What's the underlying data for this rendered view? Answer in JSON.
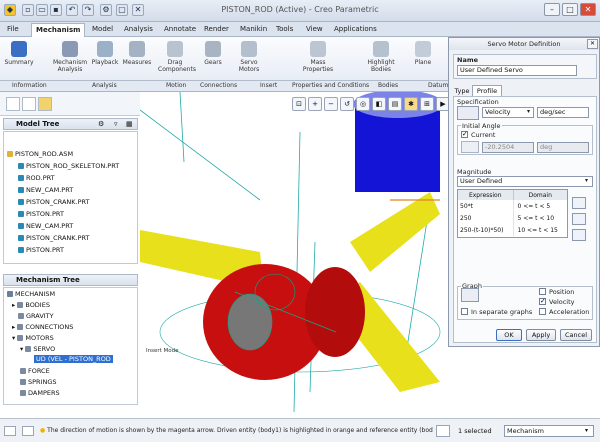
{
  "window": {
    "title": "PISTON_ROD (Active) - Creo Parametric"
  },
  "menu_tabs": [
    "File",
    "Mechanism",
    "Model",
    "Analysis",
    "Annotate",
    "Render",
    "Manikin",
    "Tools",
    "View",
    "Applications"
  ],
  "ribbon": {
    "buttons": [
      "Summary",
      "Mechanism Analysis",
      "Playback",
      "Measures",
      "Drag Components",
      "Gears",
      "Servo Motors",
      "Mass Properties",
      "Highlight Bodies",
      "Plane"
    ],
    "groups": [
      "Information",
      "Analysis",
      "Motion",
      "Connections",
      "Insert",
      "Properties and Conditions",
      "Bodies",
      "Datum"
    ]
  },
  "model_tree": {
    "header": "Model Tree",
    "items": [
      "PISTON_ROD.ASM",
      "PISTON_ROD_SKELETON.PRT",
      "ROD.PRT",
      "NEW_CAM.PRT",
      "PISTON_CRANK.PRT",
      "PISTON.PRT",
      "NEW_CAM.PRT",
      "PISTON_CRANK.PRT",
      "PISTON.PRT"
    ]
  },
  "mechanism_tree": {
    "header": "Mechanism Tree",
    "items": [
      "MECHANISM",
      "BODIES",
      "GRAVITY",
      "CONNECTIONS",
      "MOTORS",
      "SERVO",
      "UD (VEL - PISTON_ROD",
      "FORCE",
      "SPRINGS",
      "DAMPERS"
    ]
  },
  "viewport": {
    "label": "Insert Mode"
  },
  "dialog": {
    "title": "Servo Motor Definition",
    "name_label": "Name",
    "name_value": "User Defined Servo",
    "tabs": [
      "Type",
      "Profile"
    ],
    "specification_label": "Specification",
    "spec_value": "Velocity",
    "spec_unit": "deg/sec",
    "initial_angle_label": "Initial Angle",
    "current_label": "Current",
    "current_checked": true,
    "angle_value": "-20.2504",
    "angle_unit": "deg",
    "magnitude_label": "Magnitude",
    "magnitude_value": "User Defined",
    "table_headers": [
      "Expression",
      "Domain"
    ],
    "table_rows": [
      [
        "50*t",
        "0 <= t < 5"
      ],
      [
        "250",
        "5 <= t < 10"
      ],
      [
        "250-(t-10)*50)",
        "10 <= t < 15"
      ]
    ],
    "graph_label": "Graph",
    "graph_options": [
      "Position",
      "Velocity",
      "Acceleration"
    ],
    "graph_checked": [
      false,
      true,
      false
    ],
    "separate_graphs_label": "In separate graphs",
    "buttons": [
      "OK",
      "Apply",
      "Cancel"
    ]
  },
  "statusbar": {
    "message": "The direction of motion is shown by the magenta arrow. Driven entity (body1) is highlighted in orange and reference entity (bod",
    "selected": "1 selected",
    "filter": "Mechanism"
  },
  "colors": {
    "rod_yellow": "#e8e01a",
    "piston_blue": "#1414d6",
    "cam_red": "#c80f0f",
    "highlight_cyan": "#26e0e0",
    "selection_blue": "#2f6fd1"
  }
}
